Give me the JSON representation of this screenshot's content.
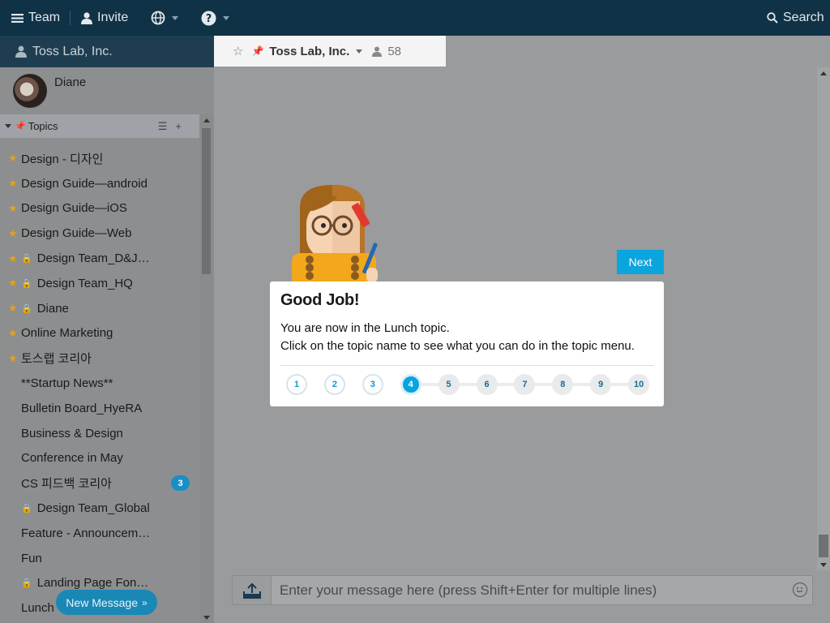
{
  "topbar": {
    "team_label": "Team",
    "invite_label": "Invite",
    "search_label": "Search"
  },
  "sidebar": {
    "team_name": "Toss Lab, Inc.",
    "user_name": "Diane",
    "topics_header": "Topics",
    "topics": [
      {
        "label": "Design - 디자인",
        "starred": true,
        "locked": false
      },
      {
        "label": "Design Guide—android",
        "starred": true,
        "locked": false
      },
      {
        "label": "Design Guide—iOS",
        "starred": true,
        "locked": false
      },
      {
        "label": "Design Guide—Web",
        "starred": true,
        "locked": false
      },
      {
        "label": "Design Team_D&J…",
        "starred": true,
        "locked": true
      },
      {
        "label": "Design Team_HQ",
        "starred": true,
        "locked": true
      },
      {
        "label": "Diane",
        "starred": true,
        "locked": true
      },
      {
        "label": "Online Marketing",
        "starred": true,
        "locked": false
      },
      {
        "label": "토스랩 코리아",
        "starred": true,
        "locked": false
      },
      {
        "label": "**Startup News**",
        "starred": false,
        "locked": false
      },
      {
        "label": "Bulletin Board_HyeRA",
        "starred": false,
        "locked": false
      },
      {
        "label": "Business & Design",
        "starred": false,
        "locked": false
      },
      {
        "label": "Conference in May",
        "starred": false,
        "locked": false
      },
      {
        "label": "CS 피드백 코리아",
        "starred": false,
        "locked": false,
        "badge": "3"
      },
      {
        "label": "Design Team_Global",
        "starred": false,
        "locked": true
      },
      {
        "label": "Feature - Announcem…",
        "starred": false,
        "locked": false
      },
      {
        "label": "Fun",
        "starred": false,
        "locked": false
      },
      {
        "label": "Landing Page Fon…",
        "starred": false,
        "locked": true
      },
      {
        "label": "Lunch",
        "starred": false,
        "locked": false
      }
    ],
    "new_message_label": "New Message"
  },
  "tab": {
    "title": "Toss Lab, Inc.",
    "member_count": "58"
  },
  "composer": {
    "placeholder": "Enter your message here (press Shift+Enter for multiple lines)"
  },
  "tutorial": {
    "next_label": "Next",
    "title": "Good Job!",
    "line1": "You are now in the Lunch topic.",
    "line2": "Click on the topic name to see what you can do in the topic menu.",
    "steps": [
      "1",
      "2",
      "3",
      "4",
      "5",
      "6",
      "7",
      "8",
      "9",
      "10"
    ],
    "current_step": 4
  },
  "colors": {
    "topbar": "#0f3246",
    "accent": "#0aa4de",
    "badge": "#1a8ec6",
    "star": "#e2a21a"
  }
}
